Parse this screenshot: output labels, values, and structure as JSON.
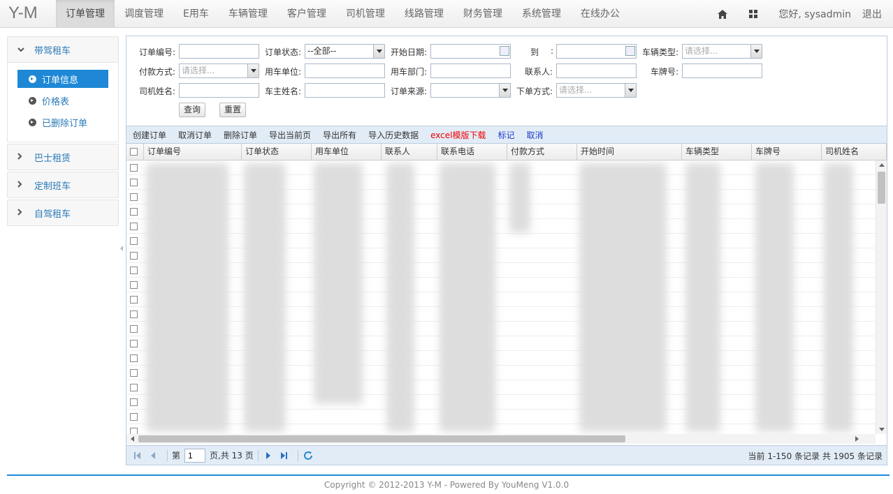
{
  "brand": "Y-M",
  "nav": [
    "订单管理",
    "调度管理",
    "E用车",
    "车辆管理",
    "客户管理",
    "司机管理",
    "线路管理",
    "财务管理",
    "系统管理",
    "在线办公"
  ],
  "top_right": {
    "greeting": "您好, sysadmin",
    "logout": "退出"
  },
  "sidebar": {
    "groups": [
      {
        "label": "带驾租车",
        "items": [
          "订单信息",
          "价格表",
          "已删除订单"
        ]
      },
      {
        "label": "巴士租赁"
      },
      {
        "label": "定制班车"
      },
      {
        "label": "自驾租车"
      }
    ]
  },
  "search": {
    "order_no": "订单编号:",
    "order_status": "订单状态:",
    "order_status_value": "--全部--",
    "start_date": "开始日期:",
    "to": "到",
    "to_colon": ":",
    "vehicle_type": "车辆类型:",
    "vehicle_type_ph": "请选择...",
    "pay_method": "付款方式:",
    "pay_method_ph": "请选择...",
    "use_unit": "用车单位:",
    "use_dept": "用车部门:",
    "contact": "联系人:",
    "plate": "车牌号:",
    "driver": "司机姓名:",
    "owner": "车主姓名:",
    "source": "订单来源:",
    "order_way": "下单方式:",
    "order_way_ph": "请选择...",
    "btn_query": "查询",
    "btn_reset": "重置"
  },
  "toolbar": [
    "创建订单",
    "取消订单",
    "删除订单",
    "导出当前页",
    "导出所有",
    "导入历史数据"
  ],
  "toolbar_red": "excel模版下载",
  "toolbar_blue": [
    "标记",
    "取消"
  ],
  "columns": [
    "订单编号",
    "订单状态",
    "用车单位",
    "联系人",
    "联系电话",
    "付款方式",
    "开始时间",
    "车辆类型",
    "车牌号",
    "司机姓名"
  ],
  "pager": {
    "page_prefix": "第",
    "page_value": "1",
    "page_suffix": "页,共 13 页",
    "info": "当前 1-150 条记录 共 1905 条记录"
  },
  "footer": "Copyright © 2012-2013 Y-M - Powered By YouMeng V1.0.0",
  "colors": {
    "accent": "#1e88d6",
    "panel_bar": "#e2ecf7",
    "toolbar_red": "#ee0000"
  }
}
